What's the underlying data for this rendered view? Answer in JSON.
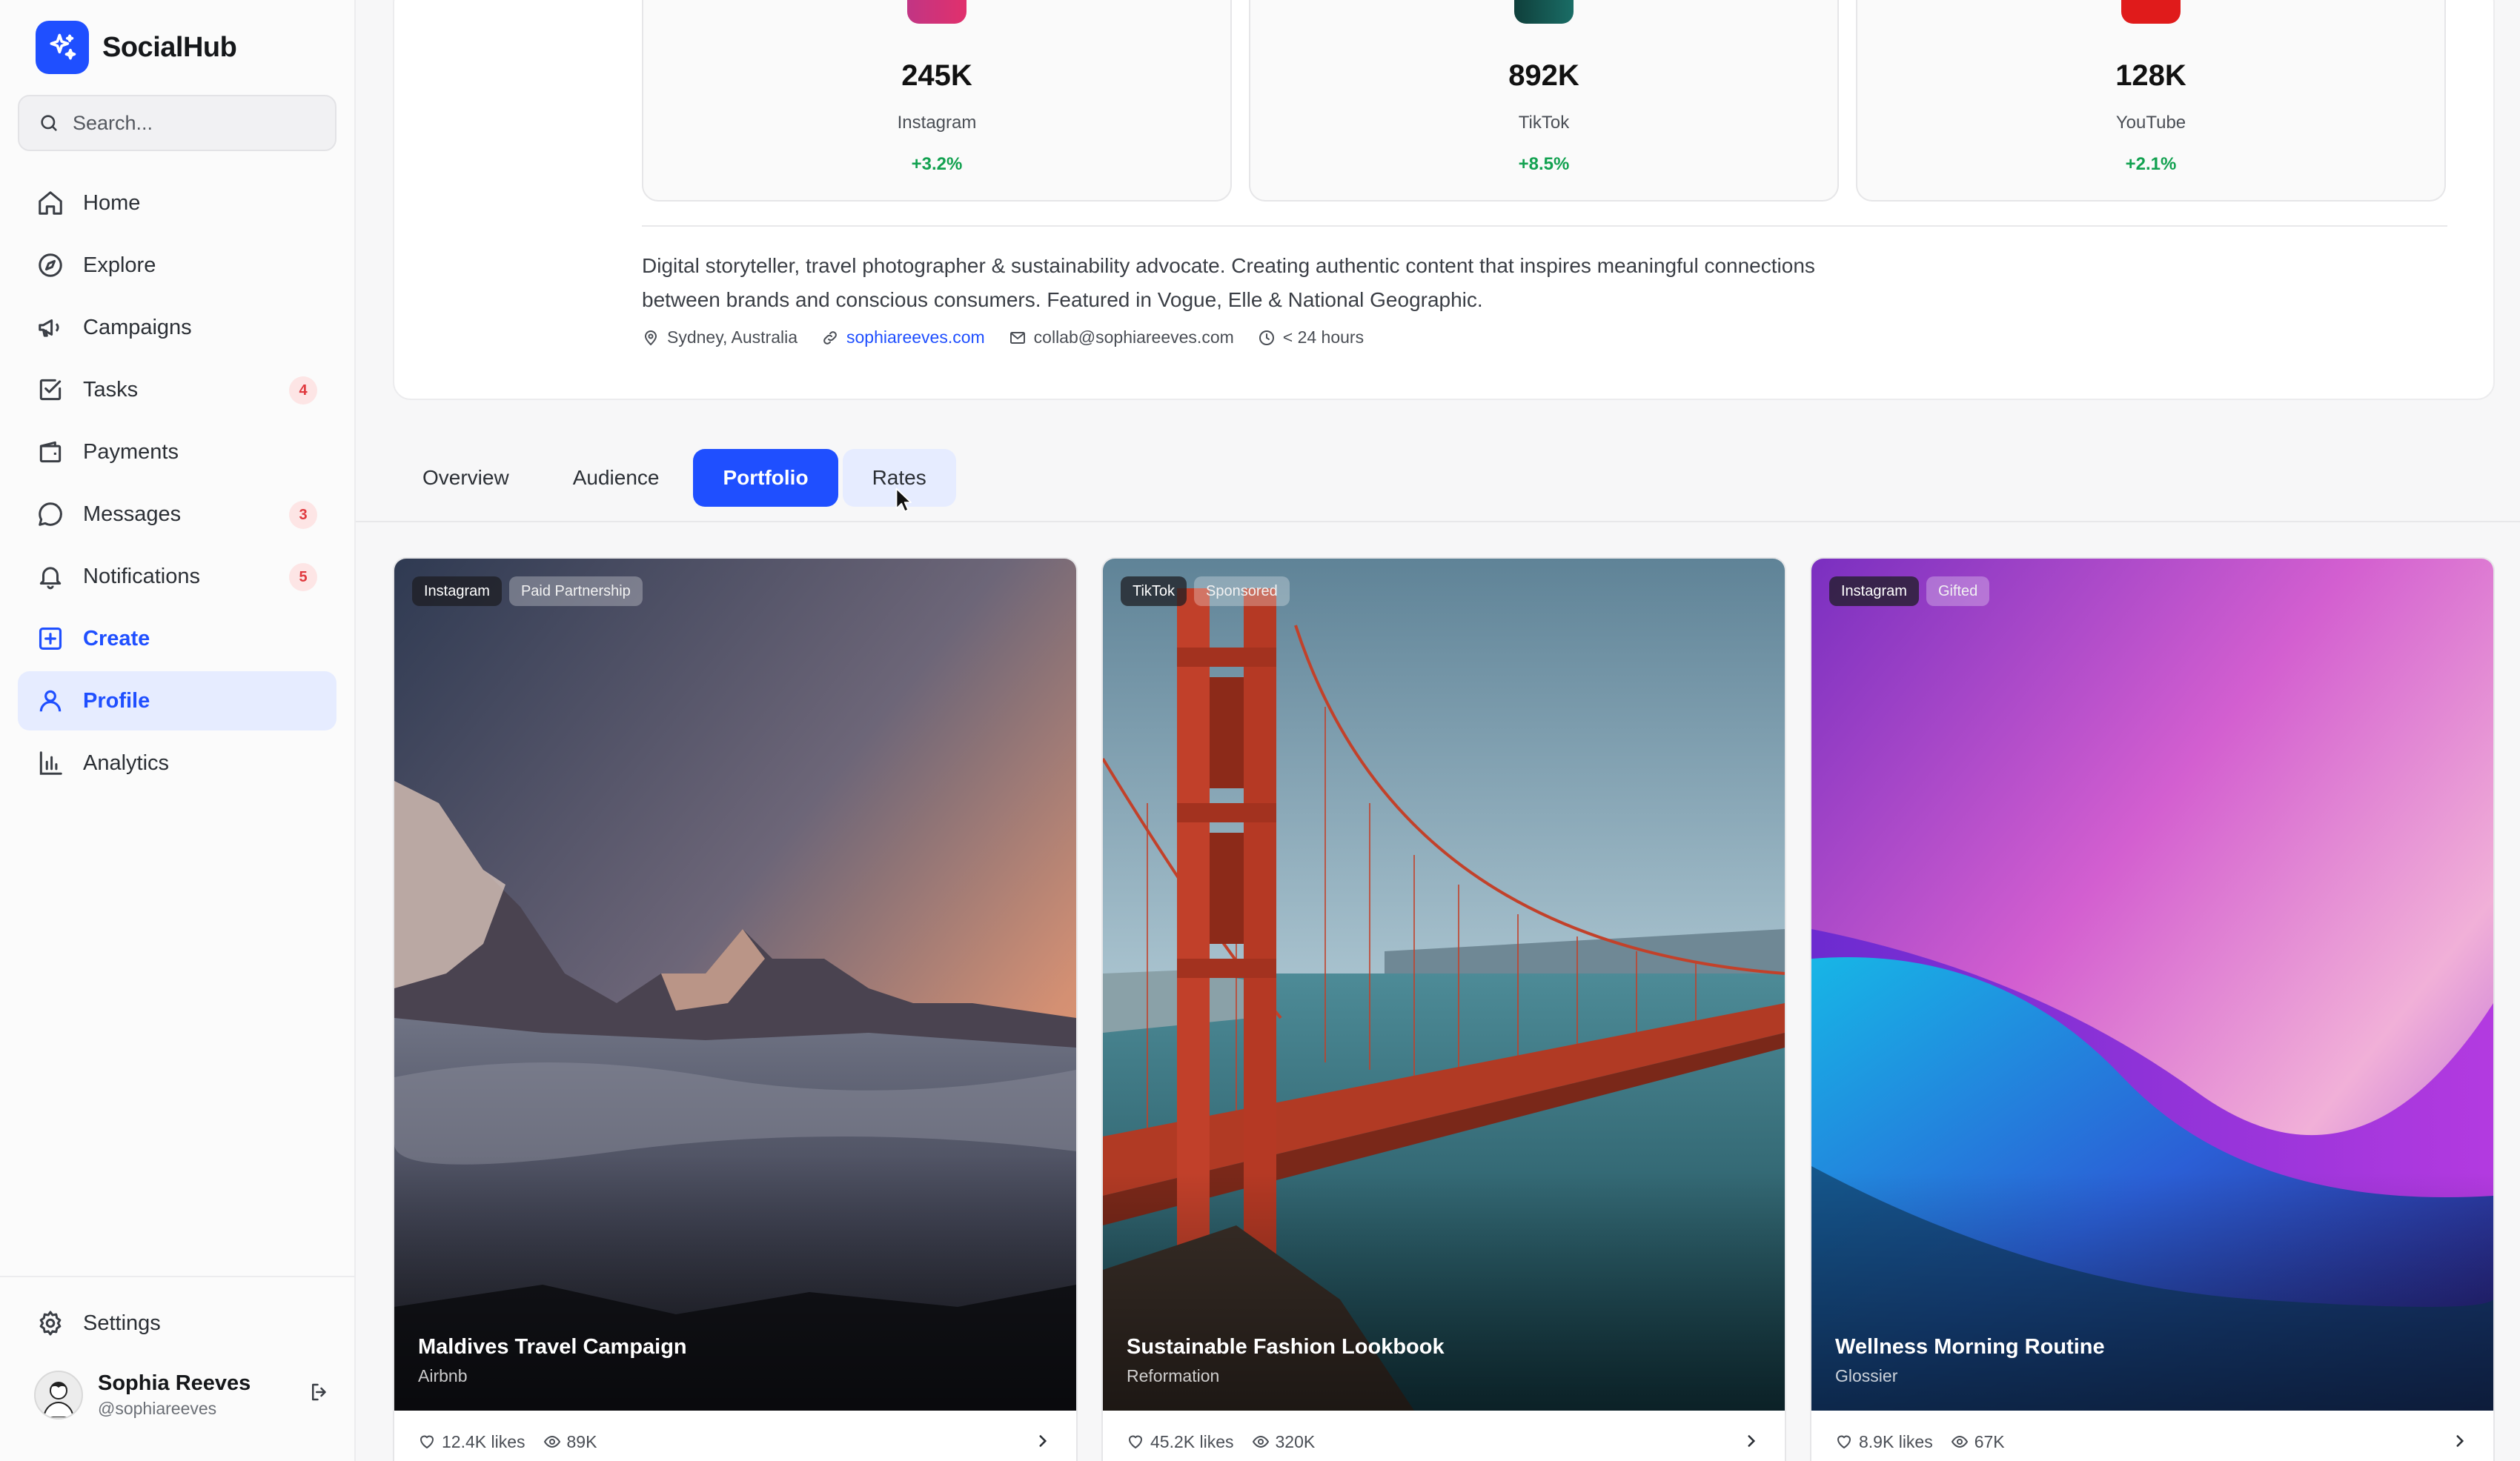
{
  "app": {
    "name": "SocialHub",
    "accent": "#1f4fff"
  },
  "search": {
    "placeholder": "Search..."
  },
  "sidebar": {
    "items": [
      {
        "label": "Home",
        "icon": "home-icon"
      },
      {
        "label": "Explore",
        "icon": "compass-icon"
      },
      {
        "label": "Campaigns",
        "icon": "megaphone-icon"
      },
      {
        "label": "Tasks",
        "icon": "checkbox-icon",
        "badge": "4"
      },
      {
        "label": "Payments",
        "icon": "wallet-icon"
      },
      {
        "label": "Messages",
        "icon": "chat-icon",
        "badge": "3"
      },
      {
        "label": "Notifications",
        "icon": "bell-icon",
        "badge": "5"
      },
      {
        "label": "Create",
        "icon": "plus-square-icon"
      },
      {
        "label": "Profile",
        "icon": "user-icon",
        "active": true
      },
      {
        "label": "Analytics",
        "icon": "bar-chart-icon"
      }
    ],
    "settings_label": "Settings"
  },
  "user": {
    "name": "Sophia Reeves",
    "handle": "@sophiareeves"
  },
  "stats": [
    {
      "value": "245K",
      "platform": "Instagram",
      "growth": "+3.2%",
      "color": "#d62f7a"
    },
    {
      "value": "892K",
      "platform": "TikTok",
      "growth": "+8.5%",
      "color": "#14605c"
    },
    {
      "value": "128K",
      "platform": "YouTube",
      "growth": "+2.1%",
      "color": "#e01b1b"
    }
  ],
  "profile": {
    "bio": "Digital storyteller, travel photographer & sustainability advocate. Creating authentic content that inspires meaningful connections between brands and conscious consumers. Featured in Vogue, Elle & National Geographic.",
    "location": "Sydney, Australia",
    "website": "sophiareeves.com",
    "email": "collab@sophiareeves.com",
    "response_time": "< 24 hours"
  },
  "tabs": [
    {
      "label": "Overview"
    },
    {
      "label": "Audience"
    },
    {
      "label": "Portfolio",
      "active": true
    },
    {
      "label": "Rates"
    }
  ],
  "portfolio": [
    {
      "title": "Maldives Travel Campaign",
      "brand": "Airbnb",
      "tags": [
        "Instagram",
        "Paid Partnership"
      ],
      "likes": "12.4K likes",
      "views": "89K"
    },
    {
      "title": "Sustainable Fashion Lookbook",
      "brand": "Reformation",
      "tags": [
        "TikTok",
        "Sponsored"
      ],
      "likes": "45.2K likes",
      "views": "320K"
    },
    {
      "title": "Wellness Morning Routine",
      "brand": "Glossier",
      "tags": [
        "Instagram",
        "Gifted"
      ],
      "likes": "8.9K likes",
      "views": "67K"
    }
  ]
}
